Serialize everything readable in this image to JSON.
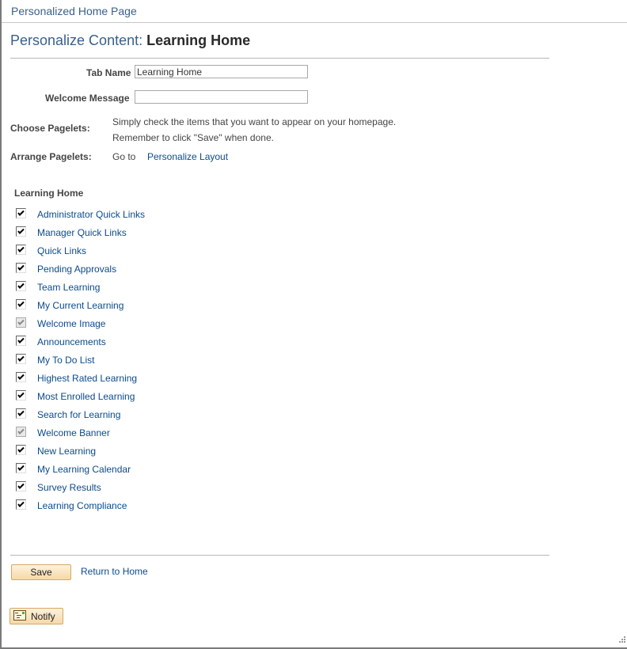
{
  "header": {
    "breadcrumb": "Personalized Home Page",
    "title_prefix": "Personalize Content:",
    "title_name": "Learning Home"
  },
  "form": {
    "tab_name_label": "Tab Name",
    "tab_name_value": "Learning Home",
    "welcome_message_label": "Welcome Message",
    "welcome_message_value": "",
    "choose_pagelets_label": "Choose Pagelets:",
    "choose_pagelets_line1": "Simply check the items that you want to appear on your homepage.",
    "choose_pagelets_line2": "Remember to click \"Save\" when done.",
    "arrange_pagelets_label": "Arrange Pagelets:",
    "arrange_goto": "Go to",
    "arrange_link": "Personalize Layout"
  },
  "pagelets": {
    "section_title": "Learning Home",
    "items": [
      {
        "label": "Administrator Quick Links",
        "checked": true,
        "disabled": false
      },
      {
        "label": "Manager Quick Links",
        "checked": true,
        "disabled": false
      },
      {
        "label": "Quick Links",
        "checked": true,
        "disabled": false
      },
      {
        "label": "Pending Approvals",
        "checked": true,
        "disabled": false
      },
      {
        "label": "Team Learning",
        "checked": true,
        "disabled": false
      },
      {
        "label": "My Current Learning",
        "checked": true,
        "disabled": false
      },
      {
        "label": "Welcome Image",
        "checked": true,
        "disabled": true
      },
      {
        "label": "Announcements",
        "checked": true,
        "disabled": false
      },
      {
        "label": "My To Do List",
        "checked": true,
        "disabled": false
      },
      {
        "label": "Highest Rated Learning",
        "checked": true,
        "disabled": false
      },
      {
        "label": "Most Enrolled Learning",
        "checked": true,
        "disabled": false
      },
      {
        "label": "Search for Learning",
        "checked": true,
        "disabled": false
      },
      {
        "label": "Welcome Banner",
        "checked": true,
        "disabled": true
      },
      {
        "label": "New Learning",
        "checked": true,
        "disabled": false
      },
      {
        "label": "My Learning Calendar",
        "checked": true,
        "disabled": false
      },
      {
        "label": "Survey Results",
        "checked": true,
        "disabled": false
      },
      {
        "label": "Learning Compliance",
        "checked": true,
        "disabled": false
      }
    ]
  },
  "footer": {
    "save_label": "Save",
    "return_link": "Return to Home",
    "notify_label": "Notify"
  }
}
